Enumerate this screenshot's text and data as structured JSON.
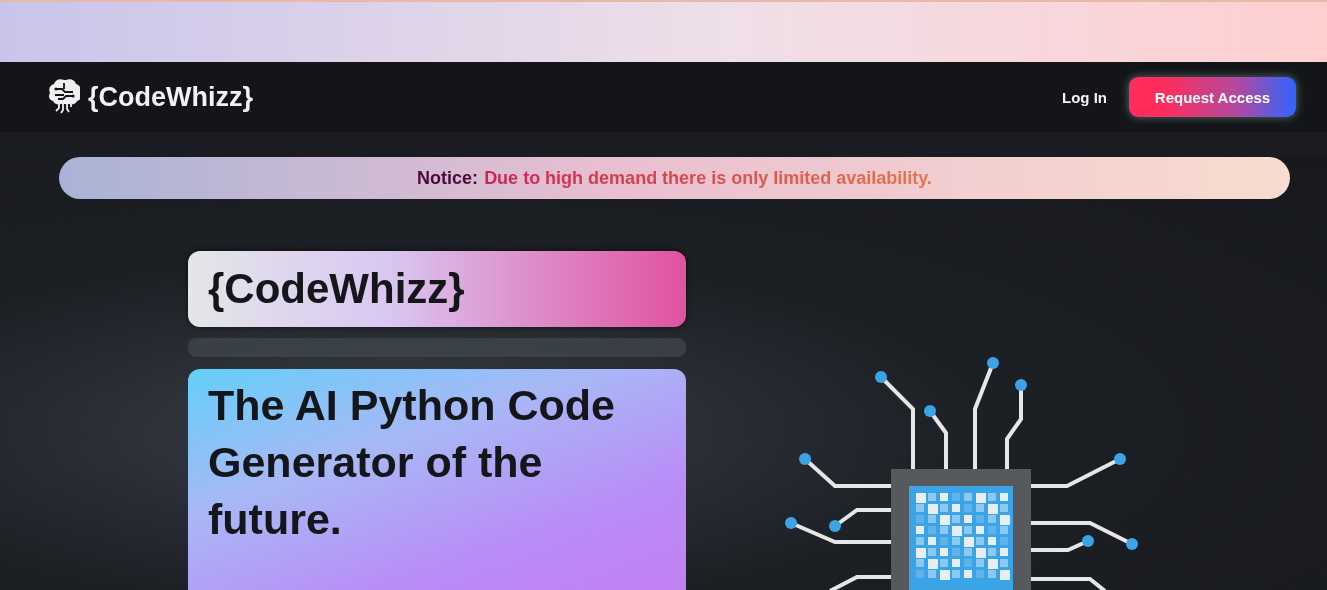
{
  "nav": {
    "brand": "{CodeWhizz}",
    "login": "Log In",
    "cta": "Request Access"
  },
  "notice": {
    "label": "Notice:",
    "message": "Due to high demand there is only limited availability."
  },
  "hero": {
    "brand": "{CodeWhizz}",
    "headline": "The AI Python Code Generator of the future."
  }
}
